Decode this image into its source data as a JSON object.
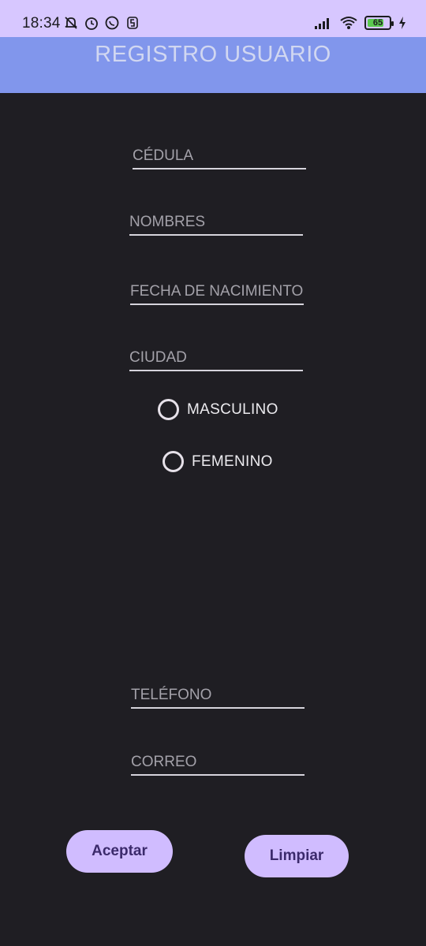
{
  "status_bar": {
    "time": "18:34",
    "battery": "65",
    "left_icons": [
      "mute-icon",
      "alarm-icon",
      "whatsapp-icon",
      "s-app-icon"
    ],
    "right_icons": [
      "signal-icon",
      "wifi-icon",
      "battery-icon",
      "charging-icon"
    ]
  },
  "app_bar": {
    "title": "REGISTRO USUARIO"
  },
  "form": {
    "cedula": "CÉDULA",
    "nombres": "NOMBRES",
    "fecha": "FECHA DE NACIMIENTO",
    "ciudad": "CIUDAD",
    "radio_masculino": "MASCULINO",
    "radio_femenino": "FEMENINO",
    "telefono": "TELÉFONO",
    "correo": "CORREO"
  },
  "buttons": {
    "aceptar": "Aceptar",
    "limpiar": "Limpiar"
  },
  "colors": {
    "background": "#1f1e23",
    "status_bar": "#d7c7ff",
    "app_bar": "#8196ec",
    "button": "#d0bcff"
  }
}
